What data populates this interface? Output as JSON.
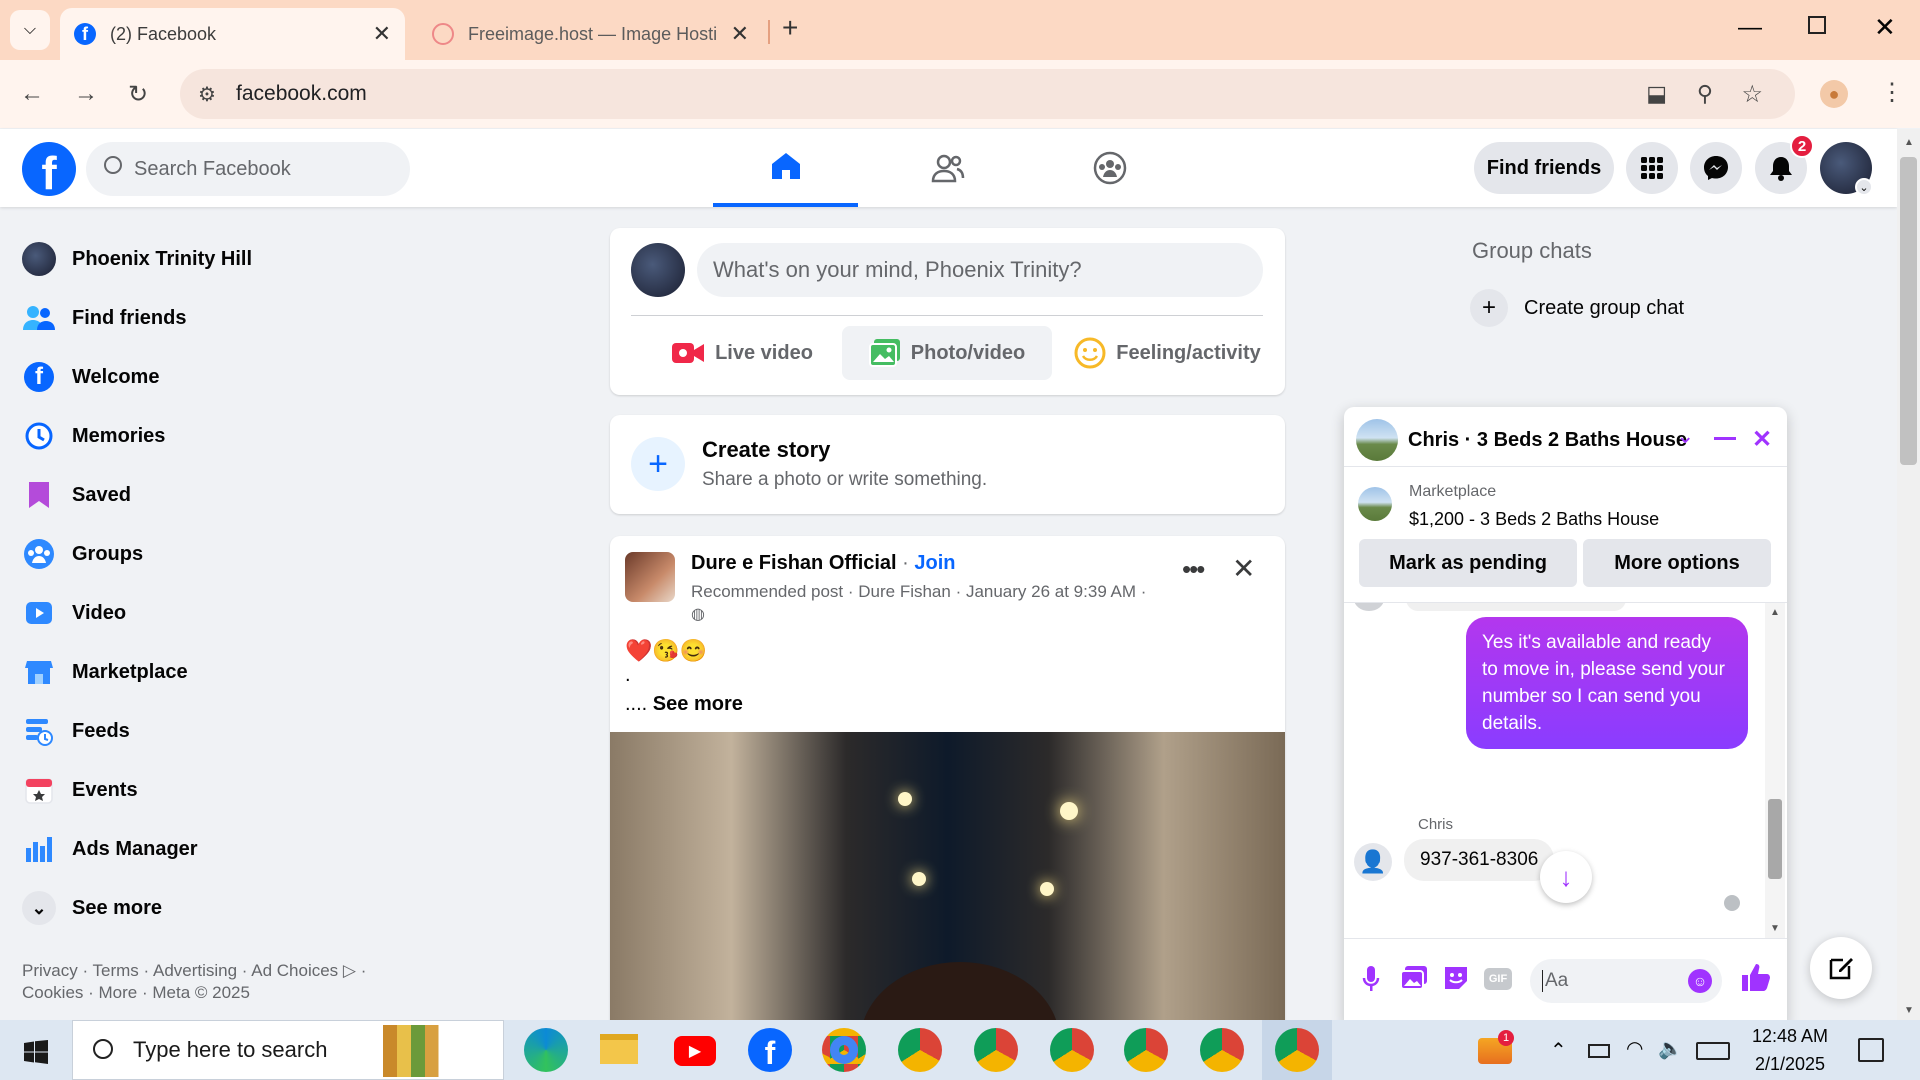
{
  "browser": {
    "tabs": [
      {
        "title": "(2) Facebook"
      },
      {
        "title": "Freeimage.host — Image Hosti"
      }
    ],
    "url": "facebook.com"
  },
  "fb": {
    "search_placeholder": "Search Facebook",
    "find_friends": "Find friends",
    "notification_count": "2"
  },
  "left_nav": {
    "items": [
      {
        "label": "Phoenix Trinity Hill",
        "icon": "profile-avatar-icon"
      },
      {
        "label": "Find friends",
        "icon": "friends-icon"
      },
      {
        "label": "Welcome",
        "icon": "facebook-icon"
      },
      {
        "label": "Memories",
        "icon": "clock-icon"
      },
      {
        "label": "Saved",
        "icon": "bookmark-icon"
      },
      {
        "label": "Groups",
        "icon": "groups-icon"
      },
      {
        "label": "Video",
        "icon": "video-icon"
      },
      {
        "label": "Marketplace",
        "icon": "shop-icon"
      },
      {
        "label": "Feeds",
        "icon": "feeds-icon"
      },
      {
        "label": "Events",
        "icon": "calendar-icon"
      },
      {
        "label": "Ads Manager",
        "icon": "bar-chart-icon"
      },
      {
        "label": "See more",
        "icon": "chevron-down-icon"
      }
    ],
    "footer_line1": "Privacy · Terms · Advertising · Ad Choices ▷ ·",
    "footer_line2": "Cookies · More · Meta © 2025"
  },
  "composer": {
    "placeholder": "What's on your mind, Phoenix Trinity?",
    "live": "Live video",
    "photo": "Photo/video",
    "feeling": "Feeling/activity"
  },
  "story": {
    "title": "Create story",
    "subtitle": "Share a photo or write something."
  },
  "post": {
    "author": "Dure e Fishan Official",
    "join": "Join",
    "meta": "Recommended post · Dure Fishan · January 26 at 9:39 AM ·",
    "emojis": "❤️😘😊",
    "dot": ".",
    "see_more_prefix": "....",
    "see_more": "See more"
  },
  "right": {
    "group_chats": "Group chats",
    "create_group": "Create group chat"
  },
  "chat": {
    "title": "Chris · 3 Beds 2 Baths House",
    "marketplace_label": "Marketplace",
    "listing": "$1,200 - 3 Beds 2 Baths House",
    "mark_pending": "Mark as pending",
    "more_options": "More options",
    "outgoing": "Yes it's available and ready to move in, please send your number so I can send you details.",
    "sender": "Chris",
    "incoming": "937-361-8306",
    "input_placeholder": "Aa",
    "accent": "#a033ff"
  },
  "taskbar": {
    "search": "Type here to search",
    "time": "12:48 AM",
    "date": "2/1/2025",
    "badge": "1"
  }
}
